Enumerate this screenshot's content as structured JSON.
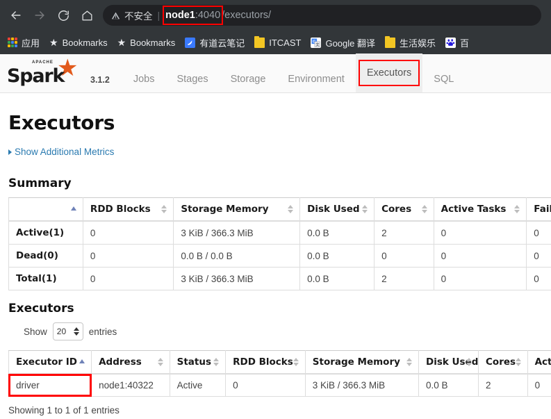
{
  "browser": {
    "back_icon": "back-arrow-icon",
    "forward_icon": "forward-arrow-icon",
    "reload_icon": "reload-icon",
    "home_icon": "home-icon",
    "security_label": "不安全",
    "separator": "|",
    "url_host": "node1",
    "url_port": ":4040",
    "url_path": "/executors/",
    "highlight_color": "#ff0000"
  },
  "bookmarks": [
    {
      "name": "apps",
      "label": "应用",
      "icon": "apps-grid-icon"
    },
    {
      "name": "bookmarks-1",
      "label": "Bookmarks",
      "icon": "star-icon"
    },
    {
      "name": "bookmarks-2",
      "label": "Bookmarks",
      "icon": "star-icon"
    },
    {
      "name": "youdao",
      "label": "有道云笔记",
      "icon": "youdao-icon"
    },
    {
      "name": "itcast",
      "label": "ITCAST",
      "icon": "folder-icon"
    },
    {
      "name": "google-translate",
      "label": "Google 翻译",
      "icon": "google-translate-icon"
    },
    {
      "name": "life-entertainment",
      "label": "生活娱乐",
      "icon": "folder-icon"
    },
    {
      "name": "baidu",
      "label": "百",
      "icon": "baidu-icon"
    }
  ],
  "spark": {
    "brand_word": "Spark",
    "brand_apache": "APACHE",
    "brand_star": "★",
    "version": "3.1.2",
    "tabs": [
      {
        "label": "Jobs",
        "active": false
      },
      {
        "label": "Stages",
        "active": false
      },
      {
        "label": "Storage",
        "active": false
      },
      {
        "label": "Environment",
        "active": false
      },
      {
        "label": "Executors",
        "active": true
      },
      {
        "label": "SQL",
        "active": false
      }
    ]
  },
  "page": {
    "title": "Executors",
    "show_metrics_link": "Show Additional Metrics",
    "summary_heading": "Summary",
    "executors_heading": "Executors"
  },
  "summary_table": {
    "headers": [
      "",
      "RDD Blocks",
      "Storage Memory",
      "Disk Used",
      "Cores",
      "Active Tasks",
      "Failed Tasks"
    ],
    "rows": [
      [
        "Active(1)",
        "0",
        "3 KiB / 366.3 MiB",
        "0.0 B",
        "2",
        "0",
        "0"
      ],
      [
        "Dead(0)",
        "0",
        "0.0 B / 0.0 B",
        "0.0 B",
        "0",
        "0",
        "0"
      ],
      [
        "Total(1)",
        "0",
        "3 KiB / 366.3 MiB",
        "0.0 B",
        "2",
        "0",
        "0"
      ]
    ]
  },
  "datatable": {
    "show_label": "Show",
    "page_size": "20",
    "entries_label": "entries",
    "info": "Showing 1 to 1 of 1 entries"
  },
  "executors_table": {
    "headers": [
      "Executor ID",
      "Address",
      "Status",
      "RDD Blocks",
      "Storage Memory",
      "Disk Used",
      "Cores",
      "Active Tasks"
    ],
    "rows": [
      [
        "driver",
        "node1:40322",
        "Active",
        "0",
        "3 KiB / 366.3 MiB",
        "0.0 B",
        "2",
        "0"
      ]
    ]
  }
}
